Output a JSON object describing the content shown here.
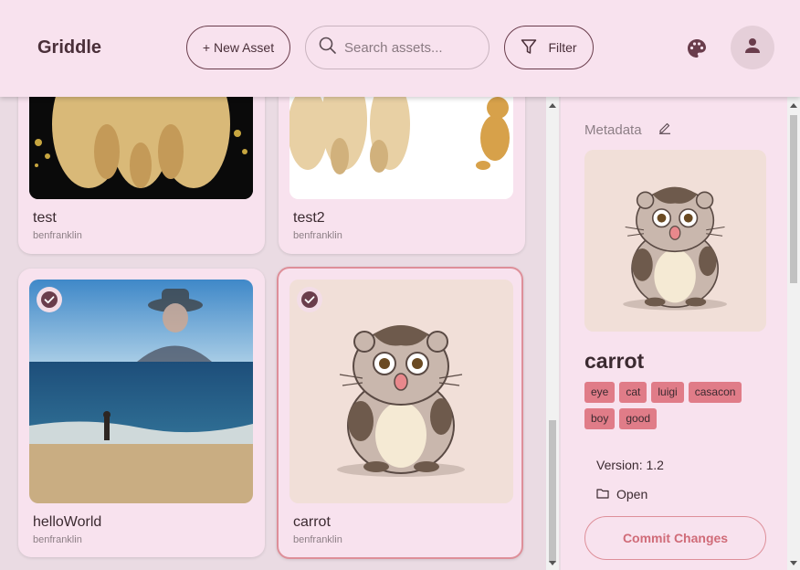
{
  "header": {
    "title": "Griddle",
    "new_asset_label": "+ New Asset",
    "search_placeholder": "Search assets...",
    "filter_label": "Filter",
    "palette_icon": "palette-icon",
    "account_icon": "person-icon"
  },
  "assets": [
    {
      "name": "test",
      "owner": "benfranklin",
      "selected": false
    },
    {
      "name": "test2",
      "owner": "benfranklin",
      "selected": false
    },
    {
      "name": "helloWorld",
      "owner": "benfranklin",
      "selected": true
    },
    {
      "name": "carrot",
      "owner": "benfranklin",
      "selected": true
    }
  ],
  "metadata": {
    "heading": "Metadata",
    "edit_icon": "pencil-icon",
    "asset_name": "carrot",
    "tags": [
      "eye",
      "cat",
      "luigi",
      "casacon",
      "boy",
      "good"
    ],
    "version_text": "Version: 1.2",
    "open_label": "Open",
    "open_icon": "folder-icon",
    "commit_label": "Commit Changes"
  },
  "colors": {
    "header_bg": "#f8e2ee",
    "page_bg": "#eadbe3",
    "accent": "#6a3d4c",
    "tag_bg": "#e07c88",
    "selected_border": "#de8f99"
  }
}
